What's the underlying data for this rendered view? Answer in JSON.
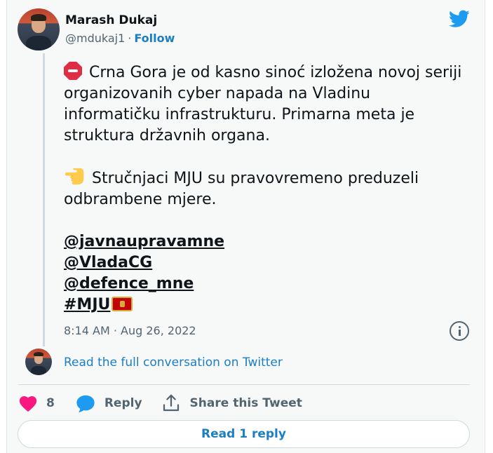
{
  "author": {
    "name": "Marash Dukaj",
    "handle": "@mdukaj1",
    "separator": "·",
    "follow_label": "Follow"
  },
  "tweet": {
    "line1_emoji": "stop-sign-icon",
    "paragraph1": "Crna Gora je od kasno sinoć izložena novoj seriji organizovanih cyber napada na Vladinu informatičku infrastrukturu. Primarna meta je struktura državnih organa.",
    "line2_emoji": "pointing-hand-icon",
    "paragraph2": "Stručnjaci MJU su pravovremeno preduzeli odbrambene mjere.",
    "mentions": [
      "@javnaupravamne",
      "@VladaCG",
      "@defence_mne"
    ],
    "hashtag": "#MJU",
    "hashtag_emoji": "montenegro-flag-icon"
  },
  "timestamp": "8:14 AM · Aug 26, 2022",
  "conversation_link": "Read the full conversation on Twitter",
  "actions": {
    "like_count": "8",
    "reply_label": "Reply",
    "share_label": "Share this Tweet"
  },
  "read_reply_label": "Read 1 reply",
  "colors": {
    "link_blue": "#1d7ec2",
    "twitter_blue": "#1d9bf0",
    "heart_pink": "#f91880",
    "text_dark": "#0f1419",
    "text_gray": "#536471",
    "card_bg": "#f7f9f9"
  }
}
